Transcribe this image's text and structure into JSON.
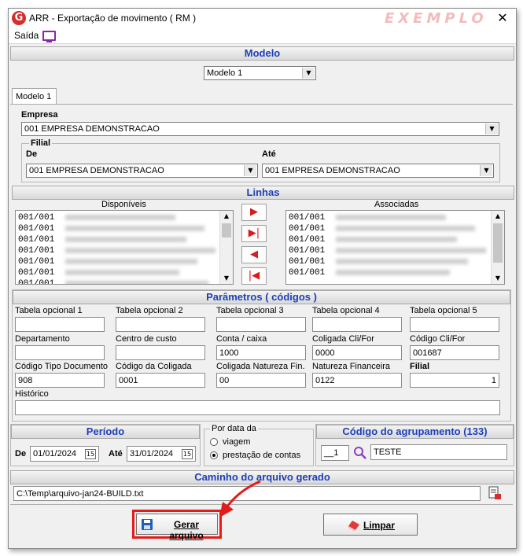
{
  "window": {
    "title": "ARR - Exportação de movimento ( RM )",
    "watermark": "EXEMPLO",
    "close": "✕"
  },
  "menu": {
    "saida": "Saída"
  },
  "modelo": {
    "header": "Modelo",
    "selected": "Modelo 1",
    "tab": "Modelo 1"
  },
  "empresa": {
    "label": "Empresa",
    "value": "001 EMPRESA DEMONSTRACAO"
  },
  "filial": {
    "group": "Filial",
    "de_label": "De",
    "de_value": "001 EMPRESA DEMONSTRACAO",
    "ate_label": "Até",
    "ate_value": "001 EMPRESA DEMONSTRACAO"
  },
  "linhas": {
    "header": "Linhas",
    "disponiveis_label": "Disponíveis",
    "associadas_label": "Associadas",
    "disponiveis": [
      "001/001",
      "001/001",
      "001/001",
      "001/001",
      "001/001",
      "001/001",
      "001/001"
    ],
    "associadas": [
      "001/001",
      "001/001",
      "001/001",
      "001/001",
      "001/001",
      "001/001"
    ]
  },
  "parametros": {
    "header": "Parâmetros ( códigos )",
    "fields": [
      {
        "label": "Tabela opcional 1",
        "value": ""
      },
      {
        "label": "Tabela opcional 2",
        "value": ""
      },
      {
        "label": "Tabela opcional 3",
        "value": ""
      },
      {
        "label": "Tabela opcional 4",
        "value": ""
      },
      {
        "label": "Tabela opcional 5",
        "value": ""
      },
      {
        "label": "Departamento",
        "value": ""
      },
      {
        "label": "Centro de custo",
        "value": ""
      },
      {
        "label": "Conta / caixa",
        "value": "1000"
      },
      {
        "label": "Coligada Cli/For",
        "value": "0000"
      },
      {
        "label": "Código Cli/For",
        "value": "001687"
      },
      {
        "label": "Código Tipo Documento",
        "value": "908"
      },
      {
        "label": "Código da Coligada",
        "value": "0001"
      },
      {
        "label": "Coligada Natureza Fin.",
        "value": "00"
      },
      {
        "label": "Natureza Financeira",
        "value": "0122"
      },
      {
        "label": "Filial",
        "value": "1"
      }
    ],
    "historico_label": "Histórico",
    "historico_value": ""
  },
  "periodo": {
    "header": "Período",
    "de_label": "De",
    "de_value": "01/01/2024",
    "ate_label": "Até",
    "ate_value": "31/01/2024",
    "cal": "15"
  },
  "por_data": {
    "group": "Por data da",
    "opt1": "viagem",
    "opt2": "prestação de contas",
    "selected": "prestação de contas"
  },
  "agrupamento": {
    "header": "Código do agrupamento (133)",
    "code": "__1",
    "value": "TESTE"
  },
  "caminho": {
    "header": "Caminho do arquivo gerado",
    "value": "C:\\Temp\\arquivo-jan24-BUILD.txt"
  },
  "buttons": {
    "gerar": "Gerar arquivo",
    "limpar": "Limpar"
  },
  "colors": {
    "section_text": "#1d3fb8",
    "highlight": "#e21b1b",
    "nav_arrow": "#d81b1b"
  },
  "icons": {
    "logo": "G",
    "monitor": "monitor-icon",
    "search": "search-icon",
    "save": "floppy-icon",
    "eraser": "eraser-icon"
  }
}
